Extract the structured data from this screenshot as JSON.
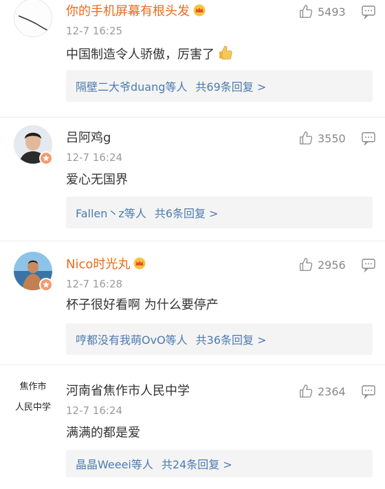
{
  "comments": [
    {
      "username": "你的手机屏幕有根头发",
      "time": "12-7 16:25",
      "likes": "5493",
      "content": "中国制造令人骄傲，厉害了",
      "reply_users": "隔壁二大爷duang等人",
      "reply_total": "共69条回复 >",
      "avatar_icon": "crack-line-avatar-icon",
      "vip": true
    },
    {
      "username": "吕阿鸡g",
      "time": "12-7 16:24",
      "likes": "3550",
      "content": "爱心无国界",
      "reply_users": "Fallen丶z等人",
      "reply_total": "共6条回复 >",
      "avatar_icon": "person-photo-avatar-icon",
      "vip": false
    },
    {
      "username": "Nico时光丸",
      "time": "12-7 16:28",
      "likes": "2956",
      "content": "杯子很好看啊 为什么要停产",
      "reply_users": "哼都没有我萌OvO等人",
      "reply_total": "共36条回复 >",
      "avatar_icon": "beach-person-avatar-icon",
      "vip": true
    },
    {
      "username": "河南省焦作市人民中学",
      "time": "12-7 16:24",
      "likes": "2364",
      "content": "满满的都是爱",
      "reply_users": "晶晶Weeei等人",
      "reply_total": "共24条回复 >",
      "avatar_icon": "school-text-avatar-icon",
      "avatar_text_line1": "焦作市",
      "avatar_text_line2": "人民中学",
      "vip": false
    }
  ],
  "colors": {
    "vip_name": "#e86b1f",
    "reply_link": "#4a7ab0",
    "meta_gray": "#9b9b9b",
    "reply_bg": "#f4f4f4"
  }
}
